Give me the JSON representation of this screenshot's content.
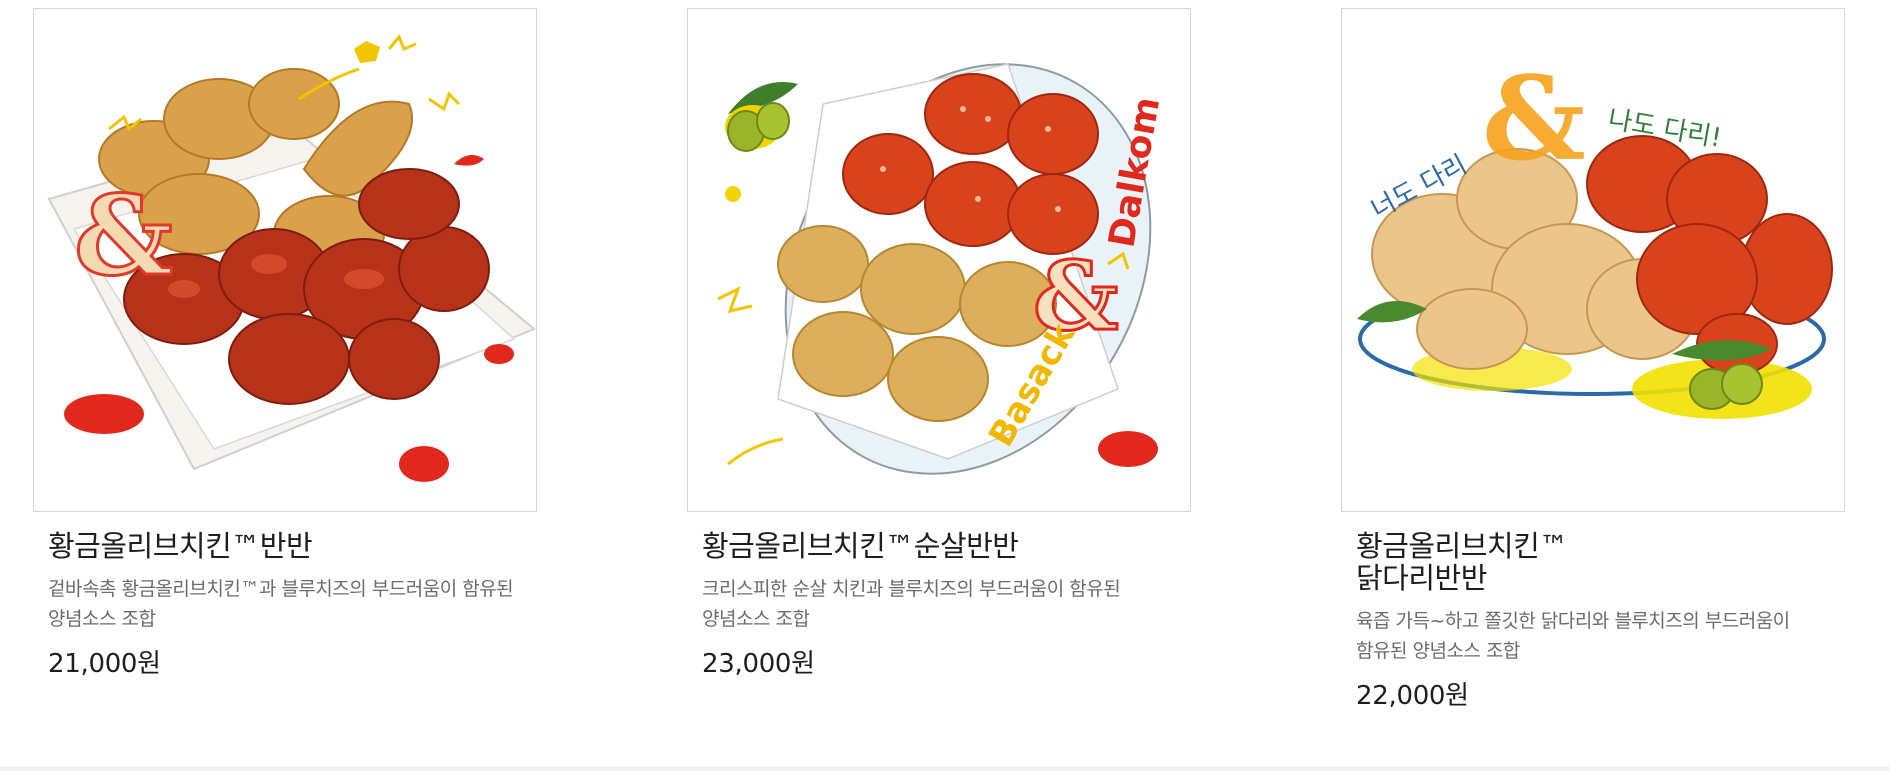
{
  "products": [
    {
      "name": "황금올리브치킨™반반",
      "description": "겉바속촉 황금올리브치킨™과 블루치즈의 부드러움이 함유된 양념소스 조합",
      "price": "21,000원",
      "image_art": {
        "script_text": ""
      }
    },
    {
      "name": "황금올리브치킨™순살반반",
      "description": "크리스피한 순살 치킨과 블루치즈의 부드러움이 함유된 양념소스 조합",
      "price": "23,000원",
      "image_art": {
        "script_text_1": "Dalkom",
        "script_text_2": "Basack"
      }
    },
    {
      "name": "황금올리브치킨™\n닭다리반반",
      "description": "육즙 가득~하고 쫄깃한 닭다리와 블루치즈의 부드러움이 함유된 양념소스 조합",
      "price": "22,000원",
      "image_art": {
        "script_text_1": "너도 다리",
        "script_text_2": "나도 다리!"
      }
    }
  ],
  "colors": {
    "fried": "#d9a24a",
    "fried_dark": "#b77725",
    "sauce": "#b8321a",
    "sauce_bright": "#d9431c",
    "olive": "#9bb52a",
    "yellow": "#f2c500",
    "blue_line": "#2b6aa8",
    "red_dot": "#e0281c"
  }
}
